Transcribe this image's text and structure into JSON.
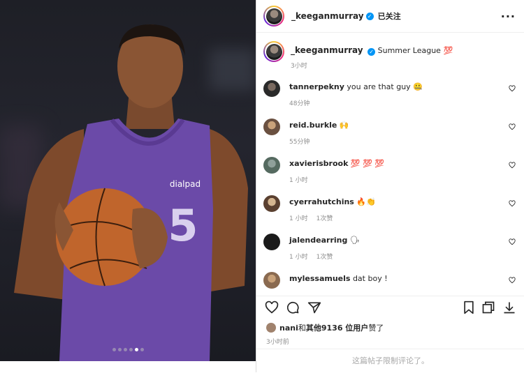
{
  "post": {
    "author": "_keeganmurray",
    "follow_status": "已关注",
    "more": "···",
    "caption_text": "Summer League",
    "caption_emoji": "💯",
    "caption_time": "3小时",
    "photo_dots": 6,
    "active_dot": 5
  },
  "comments": [
    {
      "user": "tannerpekny",
      "text": "you are that guy",
      "emoji": "🤐",
      "time": "48分钟",
      "likes": ""
    },
    {
      "user": "reid.burkle",
      "text": "",
      "emoji": "🙌",
      "time": "55分钟",
      "likes": ""
    },
    {
      "user": "xavierisbrook",
      "text": "",
      "emoji": "💯 💯 💯",
      "time": "1 小时",
      "likes": ""
    },
    {
      "user": "cyerrahutchins",
      "text": "",
      "emoji": "🔥👏",
      "time": "1 小时",
      "likes": "1次赞"
    },
    {
      "user": "jalendearring",
      "text": "",
      "emoji": "🗣",
      "time": "1 小时",
      "likes": "1次赞"
    },
    {
      "user": "mylessamuels",
      "text": "dat boy !",
      "emoji": "",
      "time": "",
      "likes": ""
    }
  ],
  "likes_line": {
    "name": "nani",
    "mid": "和",
    "others": "其他9136 位用户",
    "suffix": "赞了"
  },
  "post_time": "3小时前",
  "comments_limited": "这篇帖子限制评论了。",
  "colors": {
    "verified": "#0095f6",
    "jersey": "#6b4aa8"
  }
}
